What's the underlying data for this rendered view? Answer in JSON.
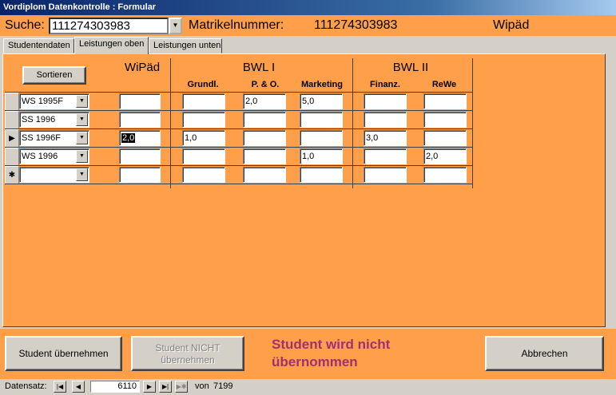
{
  "window": {
    "title": "Vordiplom Datenkontrolle : Formular"
  },
  "header": {
    "search_label": "Suche:",
    "search_value": "111274303983",
    "matrikel_label": "Matrikelnummer:",
    "matrikel_value": "111274303983",
    "program": "Wipäd"
  },
  "tabs": [
    {
      "label": "Studentendaten"
    },
    {
      "label": "Leistungen oben"
    },
    {
      "label": "Leistungen unten"
    }
  ],
  "panel": {
    "sort_button": "Sortieren",
    "groups": {
      "wipaed": "WiPäd",
      "bwl1": "BWL I",
      "bwl2": "BWL II"
    },
    "subheaders": {
      "grundl": "Grundl.",
      "pundo": "P. & O.",
      "marketing": "Marketing",
      "finanz": "Finanz.",
      "rewe": "ReWe"
    },
    "rows": [
      {
        "semester": "WS 1995F",
        "wipaed": "",
        "grundl": "",
        "pundo": "2,0",
        "marketing": "5,0",
        "finanz": "",
        "rewe": "",
        "marker": ""
      },
      {
        "semester": "SS 1996",
        "wipaed": "",
        "grundl": "",
        "pundo": "",
        "marketing": "",
        "finanz": "",
        "rewe": "",
        "marker": ""
      },
      {
        "semester": "SS 1996F",
        "wipaed": "2,0",
        "grundl": "1,0",
        "pundo": "",
        "marketing": "",
        "finanz": "3,0",
        "rewe": "",
        "marker": "▶"
      },
      {
        "semester": "WS 1996",
        "wipaed": "",
        "grundl": "",
        "pundo": "",
        "marketing": "1,0",
        "finanz": "",
        "rewe": "2,0",
        "marker": ""
      },
      {
        "semester": "",
        "wipaed": "",
        "grundl": "",
        "pundo": "",
        "marketing": "",
        "finanz": "",
        "rewe": "",
        "marker": "✱"
      }
    ]
  },
  "footer": {
    "accept_button": "Student übernehmen",
    "reject_button": "Student NICHT übernehmen",
    "message_line1": "Student wird nicht",
    "message_line2": "übernommen",
    "cancel_button": "Abbrechen"
  },
  "status": {
    "record_label": "Datensatz:",
    "record_current": "6110",
    "record_of": "von",
    "record_total": "7199"
  },
  "colors": {
    "form_bg": "#FF9F4A",
    "message": "#A0306F",
    "title_bar": "#0A246A"
  },
  "icons": {
    "first": "first-record-icon",
    "prev": "prev-record-icon",
    "next": "next-record-icon",
    "last": "last-record-icon",
    "new": "new-record-icon"
  }
}
